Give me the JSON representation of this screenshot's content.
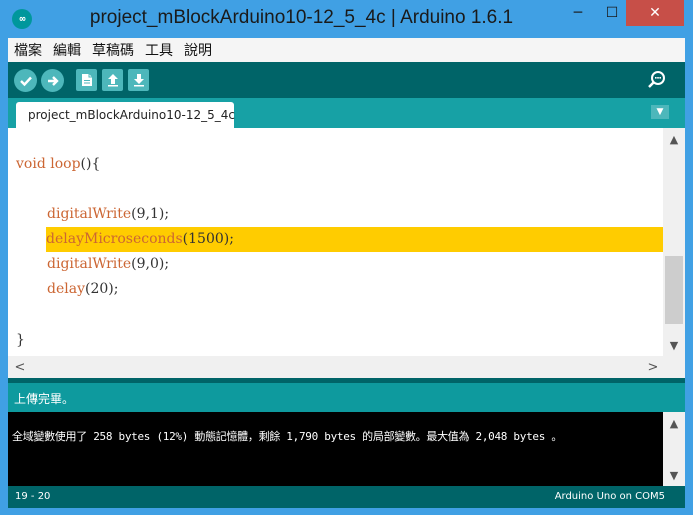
{
  "window": {
    "title": "project_mBlockArduino10-12_5_4c | Arduino 1.6.1",
    "app_icon_text": "∞",
    "minimize": "─",
    "maximize": "☐",
    "close": "✕"
  },
  "menu": {
    "items": [
      "檔案",
      "編輯",
      "草稿碼",
      "工具",
      "說明"
    ]
  },
  "toolbar": {
    "verify_glyph": "✓",
    "upload_glyph": "→",
    "new_glyph": "▯",
    "open_glyph": "↑",
    "save_glyph": "↓"
  },
  "tabs": {
    "active_label": "project_mBlockArduino10-12_5_4c",
    "menu_glyph": "▼"
  },
  "editor": {
    "lines": [
      {
        "fn": "void",
        "rest_a": " ",
        "fn2": "loop",
        "rest": "(){"
      },
      {
        "fn": "digitalWrite",
        "rest": "(9,1);"
      },
      {
        "fn": "delayMicroseconds",
        "rest": "(1500);"
      },
      {
        "fn": "digitalWrite",
        "rest": "(9,0);"
      },
      {
        "fn": "delay",
        "rest": "(20);"
      },
      {
        "fn": "",
        "rest": "}"
      }
    ],
    "scroll_up": "▲",
    "scroll_down": "▼",
    "scroll_left": "<",
    "scroll_right": ">"
  },
  "status": {
    "message": "上傳完畢。"
  },
  "console": {
    "text": "全域變數使用了 258 bytes (12%) 動態記憶體，剩餘 1,790 bytes 的局部變數。最大值為 2,048 bytes 。",
    "scroll_up": "▲",
    "scroll_down": "▼"
  },
  "footer": {
    "line_number": "19 - 20",
    "board": "Arduino Uno on COM5"
  },
  "colors": {
    "accent": "#006468",
    "teal": "#17a1a5",
    "highlight": "#ffcc00",
    "keyword": "#cc6633"
  }
}
